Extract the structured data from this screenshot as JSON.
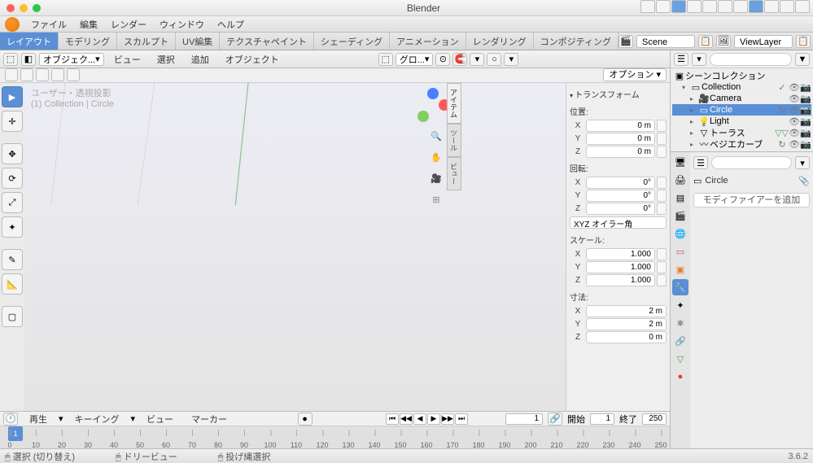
{
  "app_title": "Blender",
  "menubar": [
    "ファイル",
    "編集",
    "レンダー",
    "ウィンドウ",
    "ヘルプ"
  ],
  "tabs": [
    "レイアウト",
    "モデリング",
    "スカルプト",
    "UV編集",
    "テクスチャペイント",
    "シェーディング",
    "アニメーション",
    "レンダリング",
    "コンポジティング"
  ],
  "active_tab_index": 0,
  "scene_label": "Scene",
  "viewlayer_label": "ViewLayer",
  "viewport": {
    "mode": "オブジェク...",
    "header_menus": [
      "ビュー",
      "選択",
      "追加",
      "オブジェクト"
    ],
    "mid_dropdown": "グロ...",
    "user_perspective": "ユーザー・透視投影",
    "collection_path": "(1) Collection | Circle",
    "options": "オプション",
    "n_tabs": [
      "アイテム",
      "ツール",
      "ビュー"
    ]
  },
  "transform": {
    "title": "トランスフォーム",
    "position_label": "位置:",
    "rotation_label": "回転:",
    "scale_label": "スケール:",
    "dims_label": "寸法:",
    "euler_mode": "XYZ オイラー角",
    "position": {
      "x": "0 m",
      "y": "0 m",
      "z": "0 m"
    },
    "rotation": {
      "x": "0°",
      "y": "0°",
      "z": "0°"
    },
    "scale": {
      "x": "1.000",
      "y": "1.000",
      "z": "1.000"
    },
    "dims": {
      "x": "2 m",
      "y": "2 m",
      "z": "0 m"
    }
  },
  "outliner": {
    "root": "シーンコレクション",
    "items": [
      {
        "name": "Collection",
        "indent": 1,
        "toggle": "▾",
        "icon": "▭",
        "icons": [
          "✓",
          "👁",
          "📷"
        ]
      },
      {
        "name": "Camera",
        "indent": 2,
        "toggle": "▸",
        "icon": "🎥",
        "icons": [
          "👁",
          "📷"
        ]
      },
      {
        "name": "Circle",
        "indent": 2,
        "toggle": "▸",
        "icon": "▭",
        "sel": true,
        "icons": [
          "↻",
          "👁",
          "📷"
        ]
      },
      {
        "name": "Light",
        "indent": 2,
        "toggle": "▸",
        "icon": "💡",
        "icons": [
          "👁",
          "📷"
        ]
      },
      {
        "name": "トーラス",
        "indent": 2,
        "toggle": "▸",
        "icon": "▽",
        "extra": "▽▽",
        "icons": [
          "👁",
          "📷"
        ]
      },
      {
        "name": "ベジエカーブ",
        "indent": 2,
        "toggle": "▸",
        "icon": "〰",
        "icons": [
          "↻",
          "👁",
          "📷"
        ]
      }
    ]
  },
  "properties": {
    "object_name": "Circle",
    "add_modifier": "モディファイアーを追加"
  },
  "timeline": {
    "header_items": [
      "再生",
      "キーイング",
      "ビュー",
      "マーカー"
    ],
    "current": "1",
    "start_label": "開始",
    "start": "1",
    "end_label": "終了",
    "end": "250",
    "ticks": [
      0,
      10,
      20,
      30,
      40,
      50,
      60,
      70,
      80,
      90,
      100,
      110,
      120,
      130,
      140,
      150,
      160,
      170,
      180,
      190,
      200,
      210,
      220,
      230,
      240,
      250
    ],
    "playhead": "1"
  },
  "statusbar": {
    "left": "選択 (切り替え)",
    "mid1": "ドリービュー",
    "mid2": "投げ縄選択",
    "version": "3.6.2"
  }
}
